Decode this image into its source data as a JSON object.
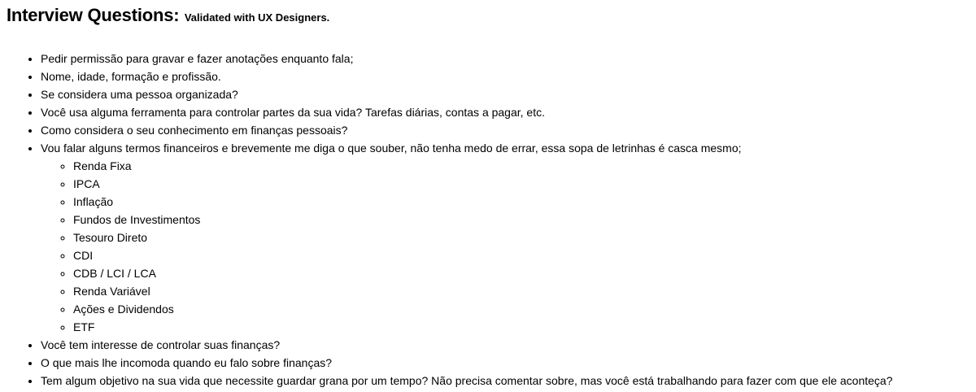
{
  "header": {
    "title": "Interview Questions:",
    "subtitle": "Validated with UX Designers."
  },
  "questions": [
    "Pedir permissão para gravar e fazer anotações enquanto fala;",
    "Nome, idade, formação e profissão.",
    "Se considera uma pessoa organizada?",
    "Você usa alguma ferramenta para controlar partes da sua vida? Tarefas diárias, contas a pagar, etc.",
    "Como considera o seu conhecimento em finanças pessoais?",
    "Vou falar alguns termos financeiros e brevemente me diga o que souber, não tenha medo de errar, essa sopa de letrinhas é casca mesmo;",
    "Você tem interesse de controlar suas finanças?",
    "O que mais lhe incomoda quando eu falo sobre finanças?",
    "Tem algum objetivo na sua vida que necessite guardar grana por um tempo? Não precisa comentar sobre, mas você está trabalhando para fazer com que ele aconteça?"
  ],
  "terms": [
    "Renda Fixa",
    "IPCA",
    "Inflação",
    "Fundos de Investimentos",
    "Tesouro Direto",
    "CDI",
    "CDB / LCI / LCA",
    "Renda Variável",
    "Ações e Dividendos",
    "ETF"
  ]
}
